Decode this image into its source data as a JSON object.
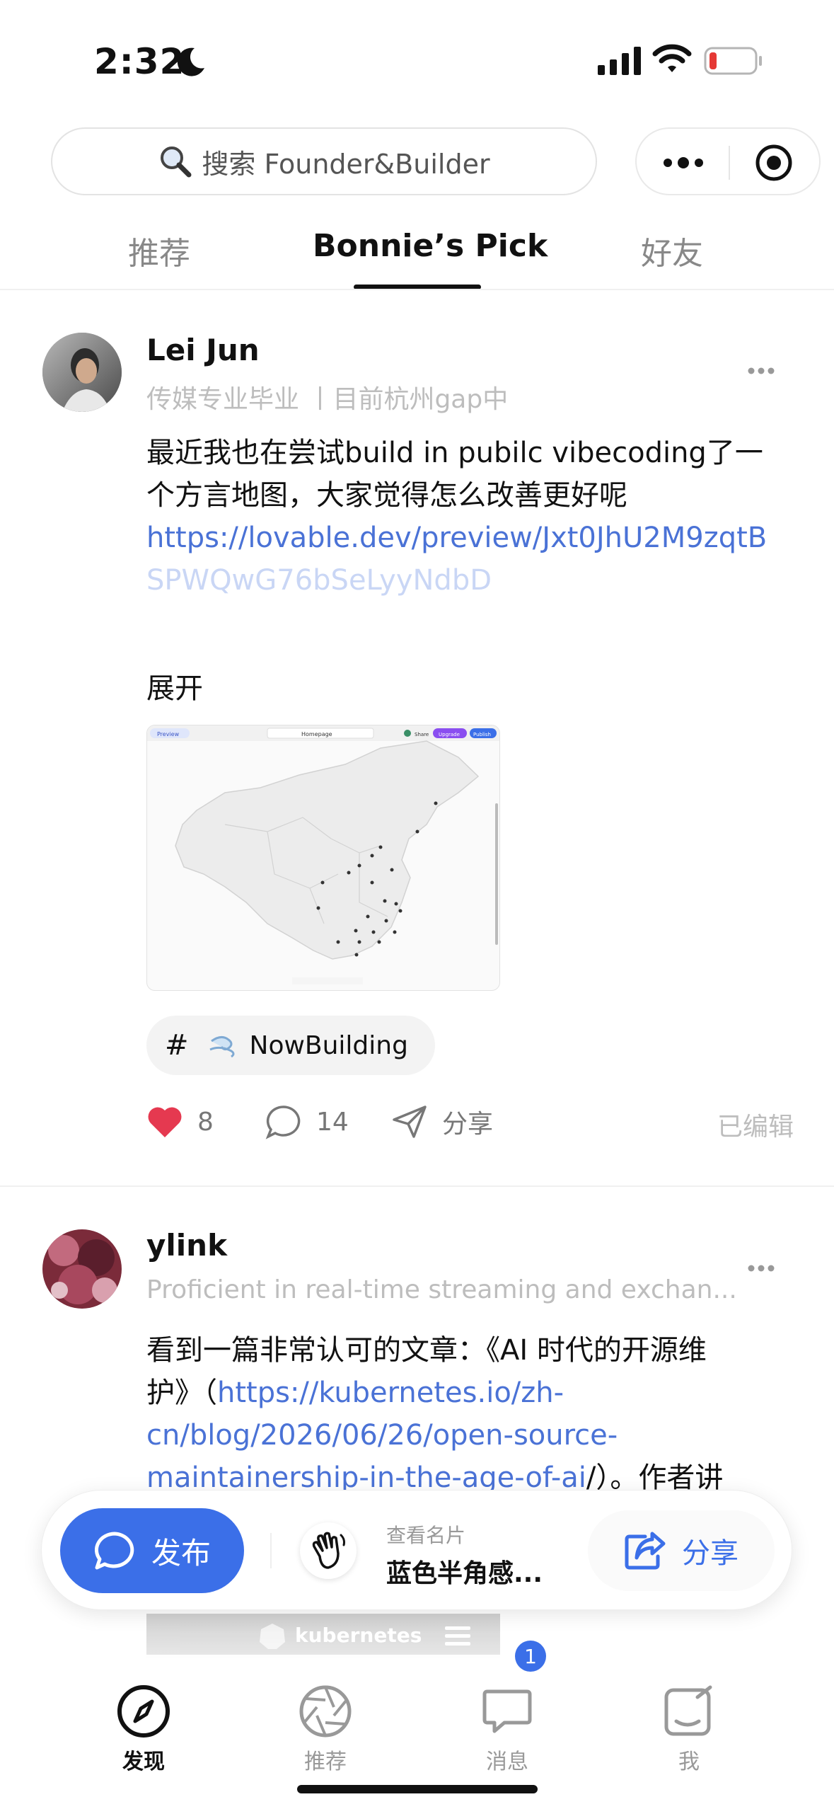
{
  "status_bar": {
    "time": "2:32",
    "battery_color": "#e53935"
  },
  "search": {
    "placeholder": "搜索 Founder&Builder"
  },
  "tabs": [
    {
      "label": "推荐",
      "active": false
    },
    {
      "label": "Bonnie’s Pick",
      "active": true
    },
    {
      "label": "好友",
      "active": false
    }
  ],
  "posts": [
    {
      "author": "Lei Jun",
      "subtitle": "传媒专业毕业 丨目前杭州gap中",
      "text": "最近我也在尝试build in pubilc vibecoding了一个方言地图，大家觉得怎么改善更好呢",
      "link_line1": "https://lovable.dev/preview/Jxt0JhU2M9zqtB",
      "link_line2": "SPWQwG76bSeLyyNdbD",
      "expand_label": "展开",
      "preview": {
        "tab_label": "Preview",
        "address": "Homepage",
        "share_label": "Share",
        "upgrade_label": "Upgrade",
        "publish_label": "Publish"
      },
      "topic": "NowBuilding",
      "likes": "8",
      "comments": "14",
      "share_label": "分享",
      "edited_label": "已编辑"
    },
    {
      "author": "ylink",
      "subtitle": "Proficient in real-time streaming and exchan...",
      "text_line1": "看到一篇非常认可的文章：《AI 时代的开源维",
      "text_line2_prefix": "护》（",
      "link_line2": "https://kubernetes.io/zh-",
      "link_line3": "cn/blog/2026/06/26/open-source-",
      "link_line4": "maintainership-in-the-age-of-ai",
      "text_line4_suffix": "/）。作者讲",
      "preview_label": "kubernetes"
    }
  ],
  "action_bar": {
    "publish_label": "发布",
    "card_caption": "查看名片",
    "card_name": "蓝色半角感...",
    "share_label": "分享",
    "accent_color": "#3b6fe8"
  },
  "tab_bar": {
    "items": [
      {
        "label": "发现",
        "icon": "compass-icon",
        "active": true
      },
      {
        "label": "推荐",
        "icon": "aperture-icon",
        "active": false
      },
      {
        "label": "消息",
        "icon": "message-icon",
        "active": false,
        "badge": "1"
      },
      {
        "label": "我",
        "icon": "profile-edit-icon",
        "active": false
      }
    ]
  }
}
